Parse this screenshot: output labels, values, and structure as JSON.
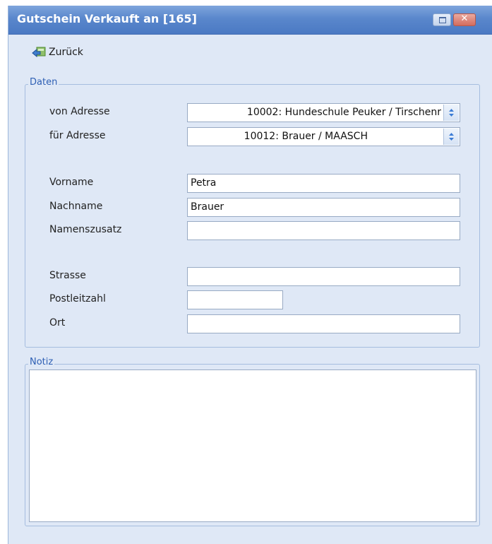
{
  "window": {
    "title": "Gutschein Verkauft an [165]"
  },
  "toolbar": {
    "back_label": "Zurück"
  },
  "daten": {
    "legend": "Daten",
    "von_adresse": {
      "label": "von Adresse",
      "value": "10002: Hundeschule Peuker / Tirschenr"
    },
    "fuer_adresse": {
      "label": "für Adresse",
      "value": "10012: Brauer / MAASCH"
    },
    "vorname": {
      "label": "Vorname",
      "value": "Petra"
    },
    "nachname": {
      "label": "Nachname",
      "value": "Brauer"
    },
    "namenszusatz": {
      "label": "Namenszusatz",
      "value": ""
    },
    "strasse": {
      "label": "Strasse",
      "value": ""
    },
    "postleitzahl": {
      "label": "Postleitzahl",
      "value": ""
    },
    "ort": {
      "label": "Ort",
      "value": ""
    }
  },
  "notiz": {
    "legend": "Notiz",
    "value": ""
  },
  "icons": {
    "back": "back-arrow-icon",
    "restore": "restore-icon",
    "close": "close-icon",
    "spinner": "up-down-spinner-icon"
  },
  "colors": {
    "titlebar": "#5a87cc",
    "window_bg": "#dfe8f6",
    "legend_text": "#2e5fb4",
    "close_button": "#d46c5e"
  }
}
